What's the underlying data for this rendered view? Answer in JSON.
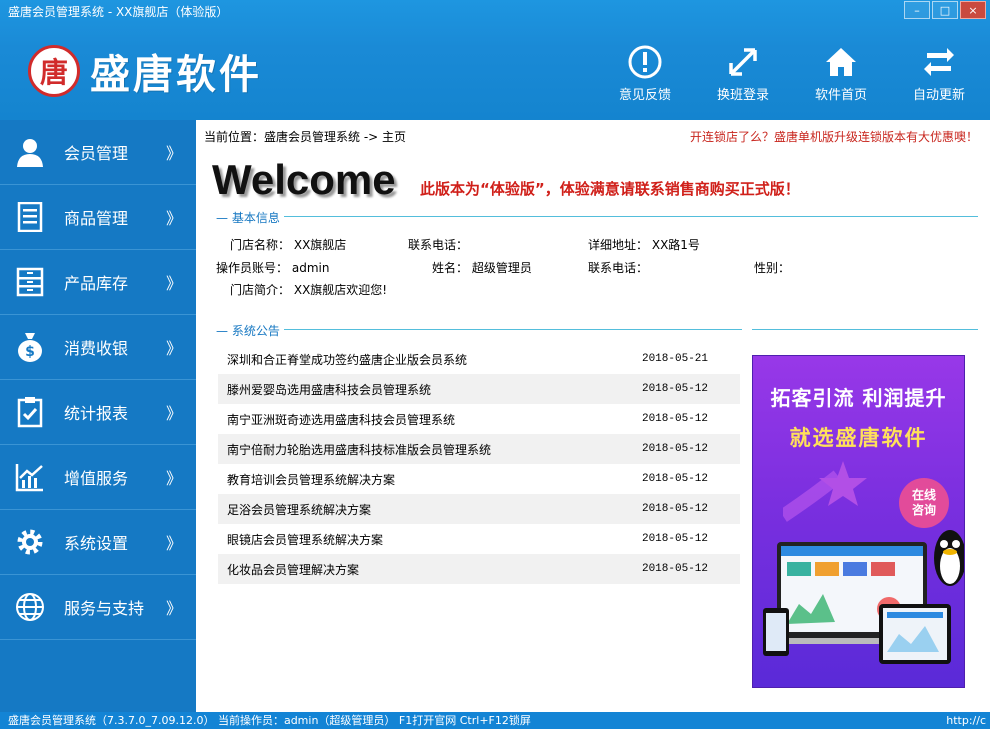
{
  "window": {
    "title": "盛唐会员管理系统 - XX旗舰店（体验版）",
    "controls": [
      "–",
      "□",
      "×"
    ]
  },
  "brand": {
    "logo_char": "唐",
    "name": "盛唐软件"
  },
  "top_actions": [
    {
      "label": "意见反馈",
      "icon": "feedback-icon"
    },
    {
      "label": "换班登录",
      "icon": "switch-shift-icon"
    },
    {
      "label": "软件首页",
      "icon": "home-icon"
    },
    {
      "label": "自动更新",
      "icon": "update-icon"
    }
  ],
  "sidebar": {
    "chevron": "》",
    "items": [
      {
        "label": "会员管理",
        "icon": "member-icon"
      },
      {
        "label": "商品管理",
        "icon": "goods-icon"
      },
      {
        "label": "产品库存",
        "icon": "inventory-icon"
      },
      {
        "label": "消费收银",
        "icon": "cashier-icon"
      },
      {
        "label": "统计报表",
        "icon": "report-icon"
      },
      {
        "label": "增值服务",
        "icon": "value-added-icon"
      },
      {
        "label": "系统设置",
        "icon": "settings-icon"
      },
      {
        "label": "服务与支持",
        "icon": "globe-icon"
      }
    ]
  },
  "main": {
    "breadcrumb": "当前位置：盛唐会员管理系统 -> 主页",
    "promo": "开连锁店了么？盛唐单机版升级连锁版本有大优惠噢！",
    "welcome": "Welcome",
    "trial_notice": "此版本为“体验版”，体验满意请联系销售商购买正式版！",
    "basic_info": {
      "title": "基本信息",
      "store_name_label": "门店名称：",
      "store_name": "XX旗舰店",
      "contact_phone_label": "联系电话：",
      "address_label": "详细地址：",
      "address": "XX路1号",
      "operator_label": "操作员账号：",
      "operator": "admin",
      "name_label": "姓名：",
      "name": "超级管理员",
      "contact_phone2_label": "联系电话：",
      "gender_label": "性别：",
      "intro_label": "门店简介：",
      "intro": "XX旗舰店欢迎您!"
    },
    "notices": {
      "title": "系统公告",
      "items": [
        {
          "text": "深圳和合正脊堂成功签约盛唐企业版会员系统",
          "date": "2018-05-21"
        },
        {
          "text": "滕州爱婴岛选用盛唐科技会员管理系统",
          "date": "2018-05-12"
        },
        {
          "text": "南宁亚洲斑奇迹选用盛唐科技会员管理系统",
          "date": "2018-05-12"
        },
        {
          "text": "南宁倍耐力轮胎选用盛唐科技标准版会员管理系统",
          "date": "2018-05-12"
        },
        {
          "text": "教育培训会员管理系统解决方案",
          "date": "2018-05-12"
        },
        {
          "text": "足浴会员管理系统解决方案",
          "date": "2018-05-12"
        },
        {
          "text": "眼镜店会员管理系统解决方案",
          "date": "2018-05-12"
        },
        {
          "text": "化妆品会员管理解决方案",
          "date": "2018-05-12"
        }
      ]
    },
    "ad": {
      "line1": "拓客引流 利润提升",
      "line2": "就选盛唐软件",
      "bubble": "在线\n咨询"
    }
  },
  "status_bar": {
    "text": "盛唐会员管理系统（7.3.7.0_7.09.12.0） 当前操作员：admin（超级管理员） F1打开官网 Ctrl+F12锁屏",
    "right": "http://c"
  },
  "colors": {
    "header_blue": "#1a8ad6",
    "sidebar_blue": "#1579c4",
    "accent_red": "#d0201a",
    "section_line": "#53bedc",
    "ad_purple": "#7a2fdf"
  }
}
